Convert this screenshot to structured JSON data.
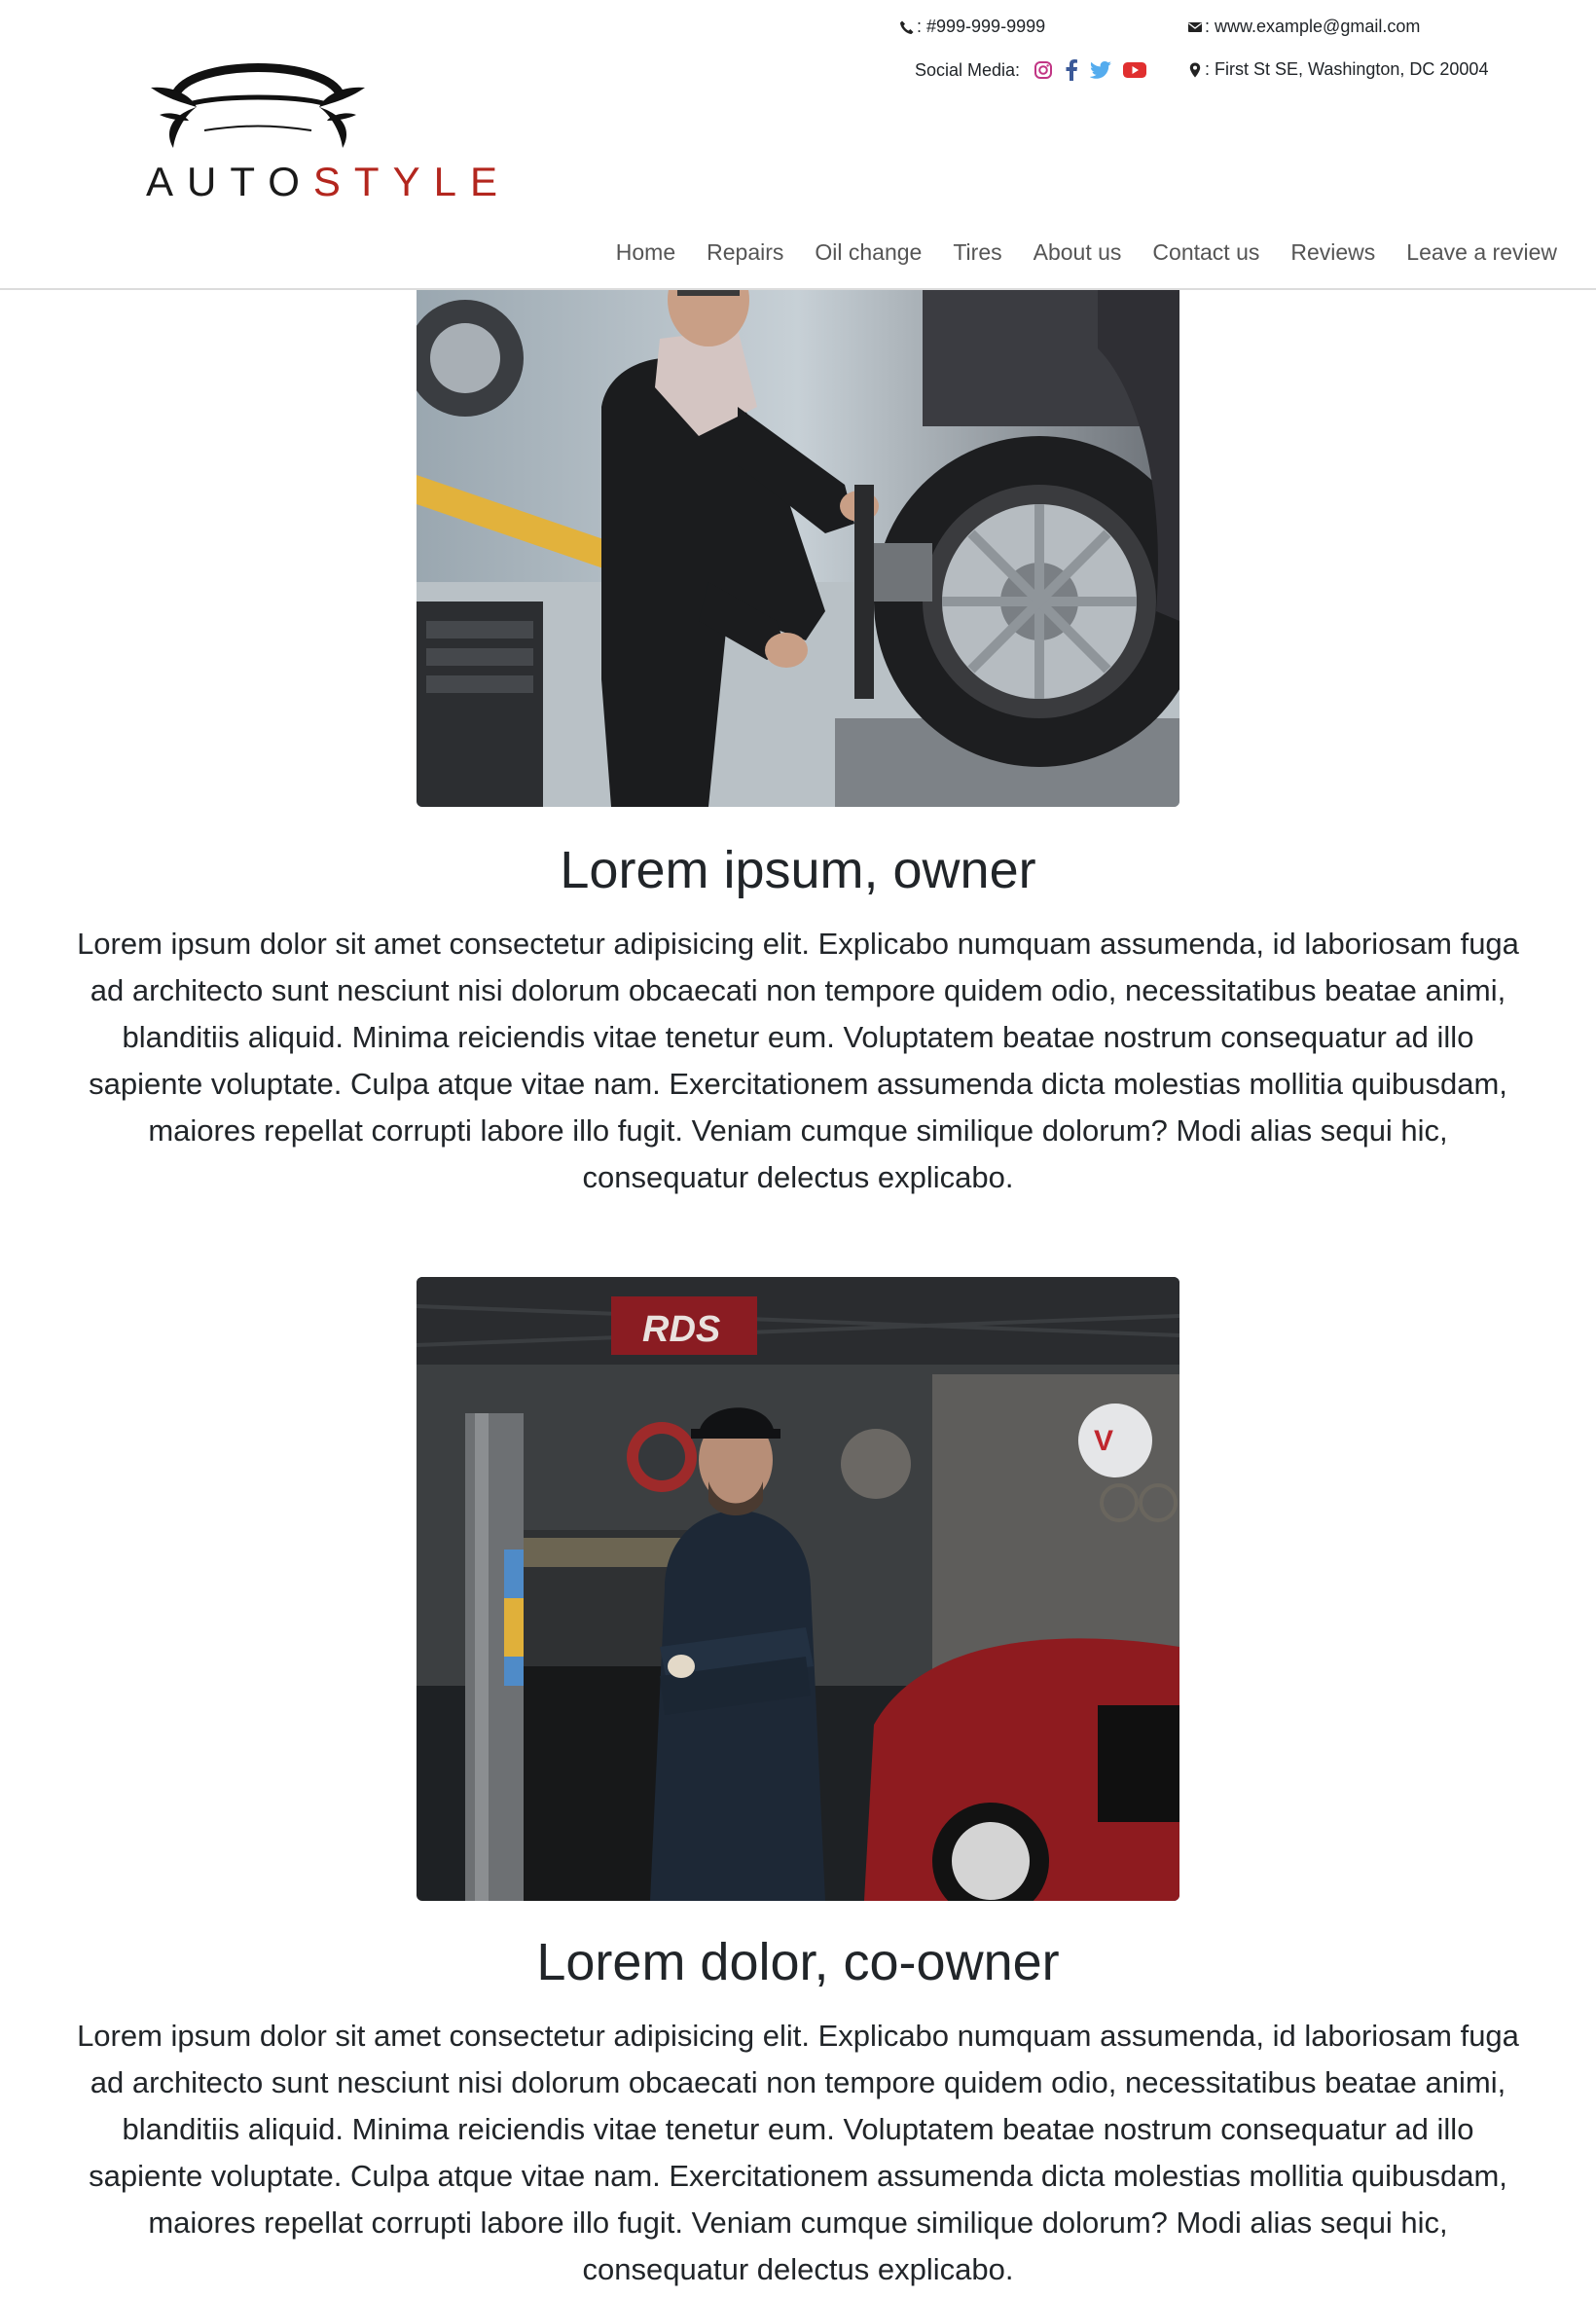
{
  "brand": {
    "logo_word_1": "AUTO",
    "logo_word_2": "STYLE",
    "accent_color": "#b3261e"
  },
  "contact": {
    "phone": ": #999-999-9999",
    "email": ": www.example@gmail.com",
    "social_label": "Social Media:",
    "address": ": First St SE, Washington, DC 20004",
    "icons": [
      "phone-icon",
      "envelope-icon",
      "instagram-icon",
      "facebook-icon",
      "twitter-icon",
      "youtube-icon",
      "map-pin-icon"
    ]
  },
  "nav": {
    "items": [
      "Home",
      "Repairs",
      "Oil change",
      "Tires",
      "About us",
      "Contact us",
      "Reviews",
      "Leave a review"
    ]
  },
  "people": [
    {
      "photo": "mechanic-adjusting-wheel-photo",
      "title": "Lorem ipsum, owner",
      "text": "Lorem ipsum dolor sit amet consectetur adipisicing elit. Explicabo numquam assumenda, id laboriosam fuga ad architecto sunt nesciunt nisi dolorum obcaecati non tempore quidem odio, necessitatibus beatae animi, blanditiis aliquid. Minima reiciendis vitae tenetur eum. Voluptatem beatae nostrum consequatur ad illo sapiente voluptate. Culpa atque vitae nam. Exercitationem assumenda dicta molestias mollitia quibusdam, maiores repellat corrupti labore illo fugit. Veniam cumque similique dolorum? Modi alias sequi hic, consequatur delectus explicabo."
    },
    {
      "photo": "mechanic-in-garage-photo",
      "title": "Lorem dolor, co-owner",
      "text": "Lorem ipsum dolor sit amet consectetur adipisicing elit. Explicabo numquam assumenda, id laboriosam fuga ad architecto sunt nesciunt nisi dolorum obcaecati non tempore quidem odio, necessitatibus beatae animi, blanditiis aliquid. Minima reiciendis vitae tenetur eum. Voluptatem beatae nostrum consequatur ad illo sapiente voluptate. Culpa atque vitae nam. Exercitationem assumenda dicta molestias mollitia quibusdam, maiores repellat corrupti labore illo fugit. Veniam cumque similique dolorum? Modi alias sequi hic, consequatur delectus explicabo."
    }
  ]
}
